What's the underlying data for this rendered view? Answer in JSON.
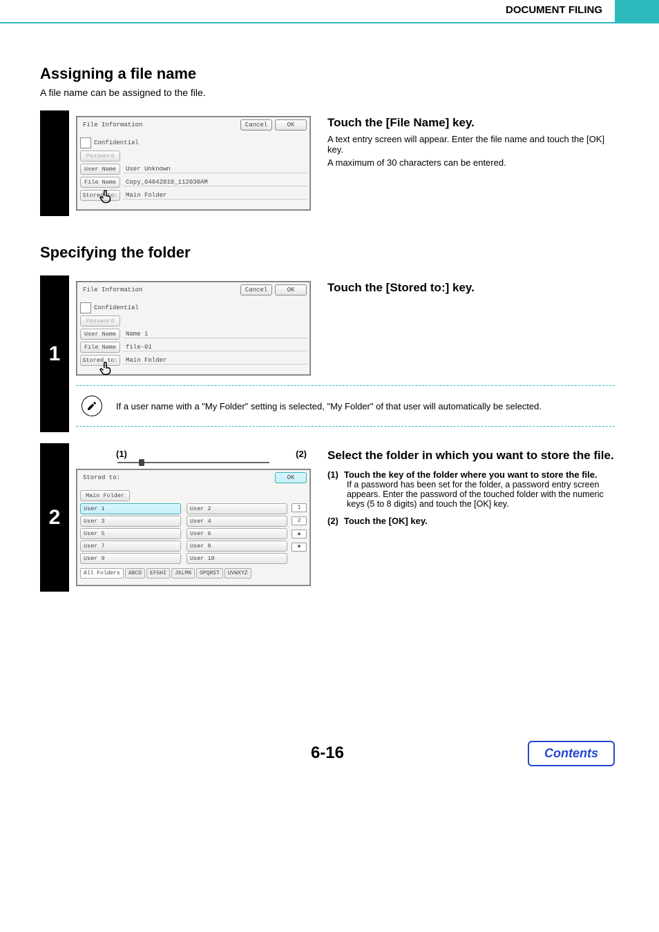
{
  "header": {
    "section": "DOCUMENT FILING"
  },
  "section_a": {
    "title": "Assigning a file name",
    "lead": "A file name can be assigned to the file.",
    "panel": {
      "title": "File Information",
      "cancel": "Cancel",
      "ok": "OK",
      "confidential": "Confidential",
      "password_btn": "Password",
      "user_name_btn": "User Name",
      "user_name_val": "User Unknown",
      "file_name_btn": "File Name",
      "file_name_val": "Copy_04042010_112030AM",
      "stored_btn": "Stored to:",
      "stored_val": "Main Folder"
    },
    "right": {
      "heading": "Touch the [File Name] key.",
      "p1": "A text entry screen will appear. Enter the file name and touch the [OK] key.",
      "p2": "A maximum of 30 characters can be entered."
    }
  },
  "section_b": {
    "title": "Specifying the folder"
  },
  "step1": {
    "num": "1",
    "panel": {
      "title": "File Information",
      "cancel": "Cancel",
      "ok": "OK",
      "confidential": "Confidential",
      "password_btn": "Password",
      "user_name_btn": "User Name",
      "user_name_val": "Name 1",
      "file_name_btn": "File Name",
      "file_name_val": "file-01",
      "stored_btn": "Stored to:",
      "stored_val": "Main Folder"
    },
    "right": {
      "heading": "Touch the [Stored to:] key."
    },
    "note": "If a user name with a \"My Folder\" setting is selected, \"My Folder\" of that user will automatically be selected."
  },
  "step2": {
    "num": "2",
    "callouts": {
      "c1": "(1)",
      "c2": "(2)"
    },
    "panel": {
      "title": "Stored to:",
      "ok": "OK",
      "main": "Main Folder",
      "users": [
        "User 1",
        "User 2",
        "User 3",
        "User 4",
        "User 5",
        "User 6",
        "User 7",
        "User 8",
        "User 9",
        "User 10"
      ],
      "page_top": "1",
      "page_bot": "2",
      "tabs": [
        "All Folders",
        "ABCD",
        "EFGHI",
        "JKLMN",
        "OPQRST",
        "UVWXYZ"
      ]
    },
    "right": {
      "heading": "Select the folder in which you want to store the file.",
      "li1_num": "(1)",
      "li1_head": "Touch the key of the folder where you want to store the file.",
      "li1_body": "If a password has been set for the folder, a password entry screen appears. Enter the password of the touched folder with the numeric keys (5 to 8 digits) and touch the [OK] key.",
      "li2_num": "(2)",
      "li2_head": "Touch the [OK] key."
    }
  },
  "footer": {
    "page": "6-16",
    "contents": "Contents"
  }
}
